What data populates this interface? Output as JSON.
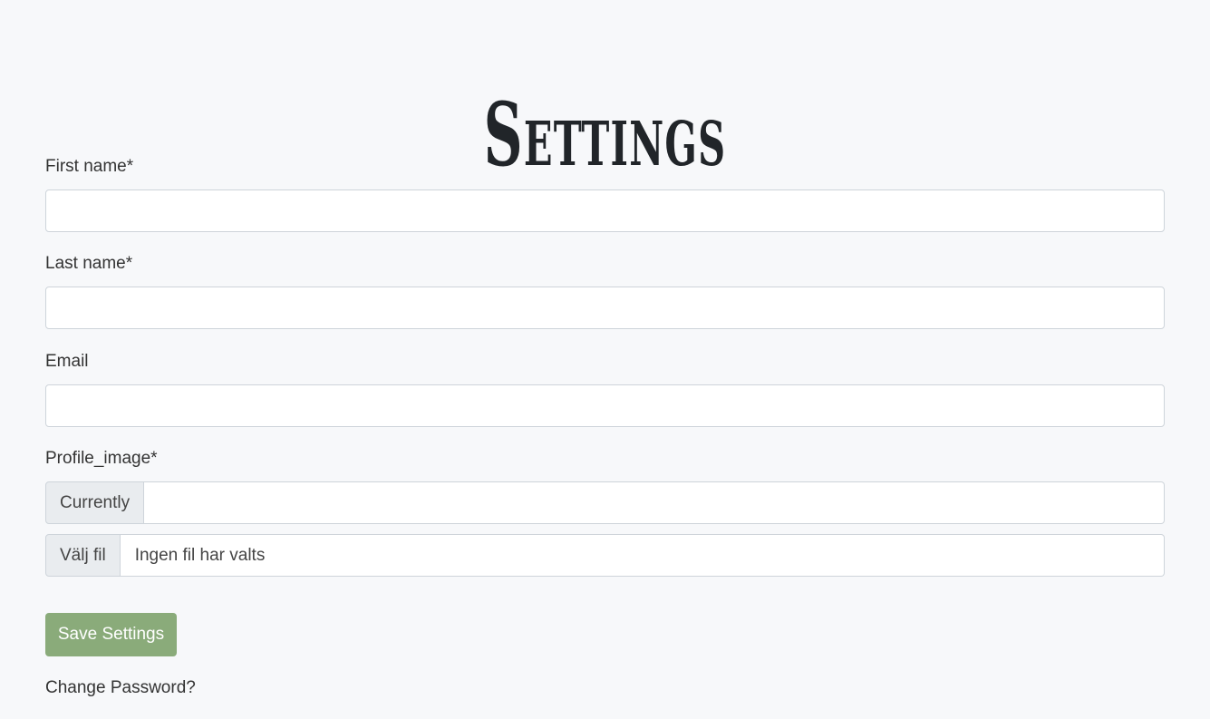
{
  "page": {
    "title": "Settings"
  },
  "form": {
    "first_name": {
      "label": "First name*",
      "value": ""
    },
    "last_name": {
      "label": "Last name*",
      "value": ""
    },
    "email": {
      "label": "Email",
      "value": ""
    },
    "profile_image": {
      "label": "Profile_image*",
      "currently_label": "Currently",
      "currently_value": "",
      "choose_file_label": "Välj fil",
      "no_file_text": "Ingen fil har valts"
    },
    "save_label": "Save Settings",
    "change_password_label": "Change Password?"
  },
  "colors": {
    "background": "#f7f8fa",
    "primary_button": "#8aab7a",
    "addon_background": "#e9ecef",
    "border": "#ced4da"
  }
}
